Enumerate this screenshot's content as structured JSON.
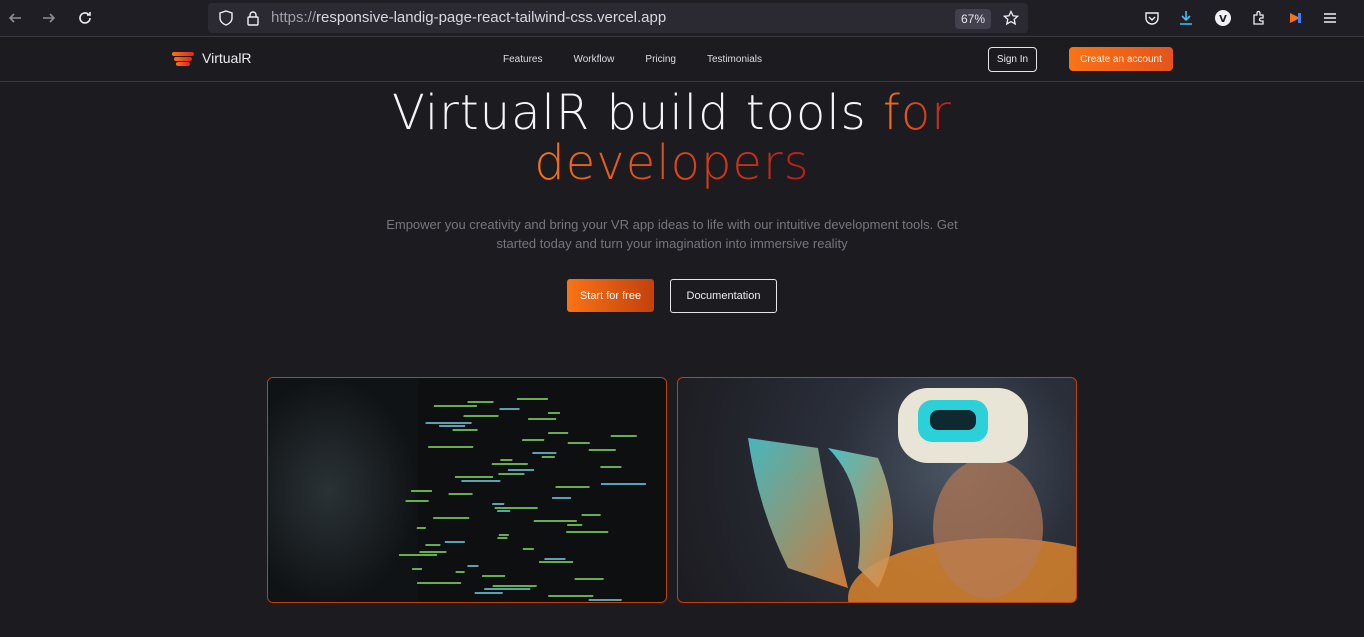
{
  "browser": {
    "url_prefix": "https://",
    "url_host": "responsive-landig-page-react-tailwind-css.vercel.app",
    "zoom": "67%",
    "profile_initial": "V"
  },
  "nav": {
    "brand": "VirtualR",
    "links": [
      "Features",
      "Workflow",
      "Pricing",
      "Testimonials"
    ],
    "sign_in": "Sign In",
    "create_account": "Create an account"
  },
  "hero": {
    "title_main": "VirtualR build tools",
    "title_accent_1": "for",
    "title_accent_2": "developers",
    "subtitle": "Empower you creativity and bring your VR app ideas to life with our intuitive development tools. Get started today and turn your imagination into immersive reality",
    "primary_cta": "Start for free",
    "secondary_cta": "Documentation"
  },
  "colors": {
    "accent_start": "#f97316",
    "accent_end": "#b91c1c",
    "background": "#1c1b20"
  }
}
